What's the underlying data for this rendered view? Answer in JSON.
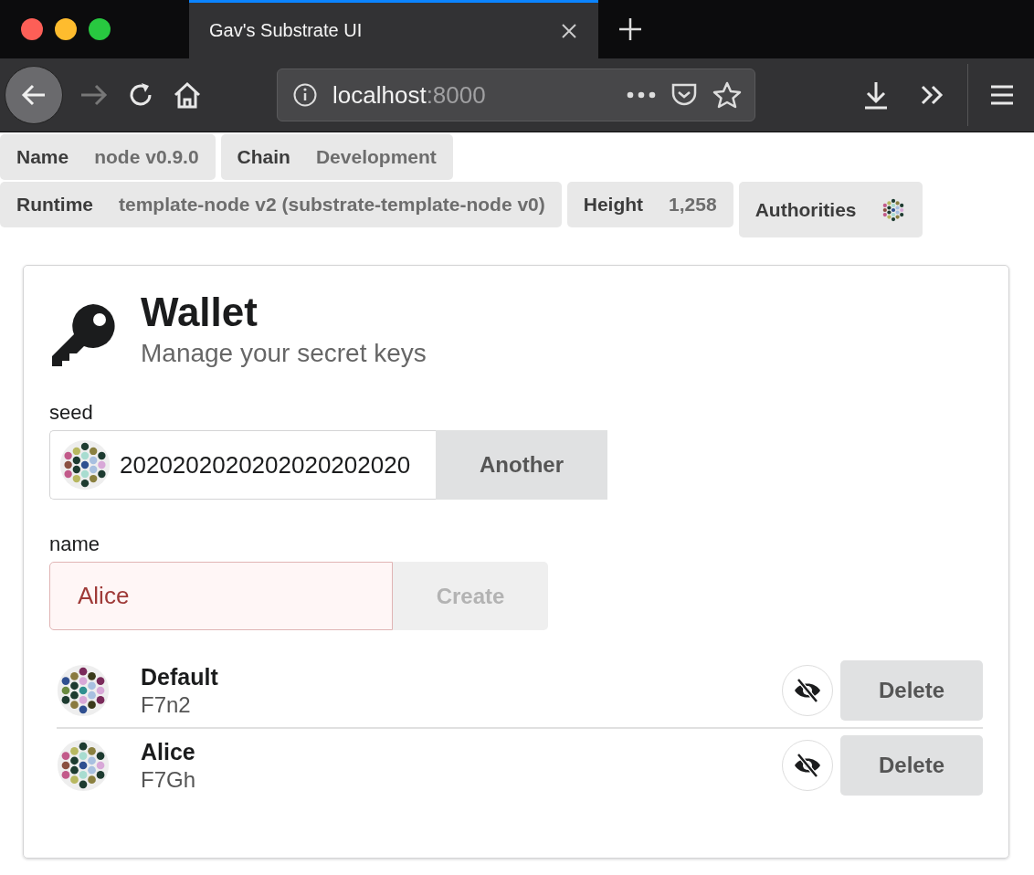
{
  "browser": {
    "tab_title": "Gav's Substrate UI",
    "url_host": "localhost",
    "url_port": ":8000"
  },
  "status_labels": [
    {
      "label": "Name",
      "value": "node v0.9.0"
    },
    {
      "label": "Chain",
      "value": "Development"
    },
    {
      "label": "Runtime",
      "value": "template-node v2 (substrate-template-node v0)"
    },
    {
      "label": "Height",
      "value": "1,258"
    },
    {
      "label": "Authorities",
      "kind": "identicons"
    }
  ],
  "wallet": {
    "title": "Wallet",
    "subtitle": "Manage your secret keys",
    "seed": {
      "label": "seed",
      "value": "2020202020202020202020",
      "button": "Another"
    },
    "name": {
      "label": "name",
      "value": "Alice",
      "error": true,
      "button": "Create",
      "disabled": true
    },
    "accounts": [
      {
        "name": "Default",
        "address": "F7n2",
        "button": "Delete"
      },
      {
        "name": "Alice",
        "address": "F7Gh",
        "button": "Delete"
      }
    ]
  }
}
